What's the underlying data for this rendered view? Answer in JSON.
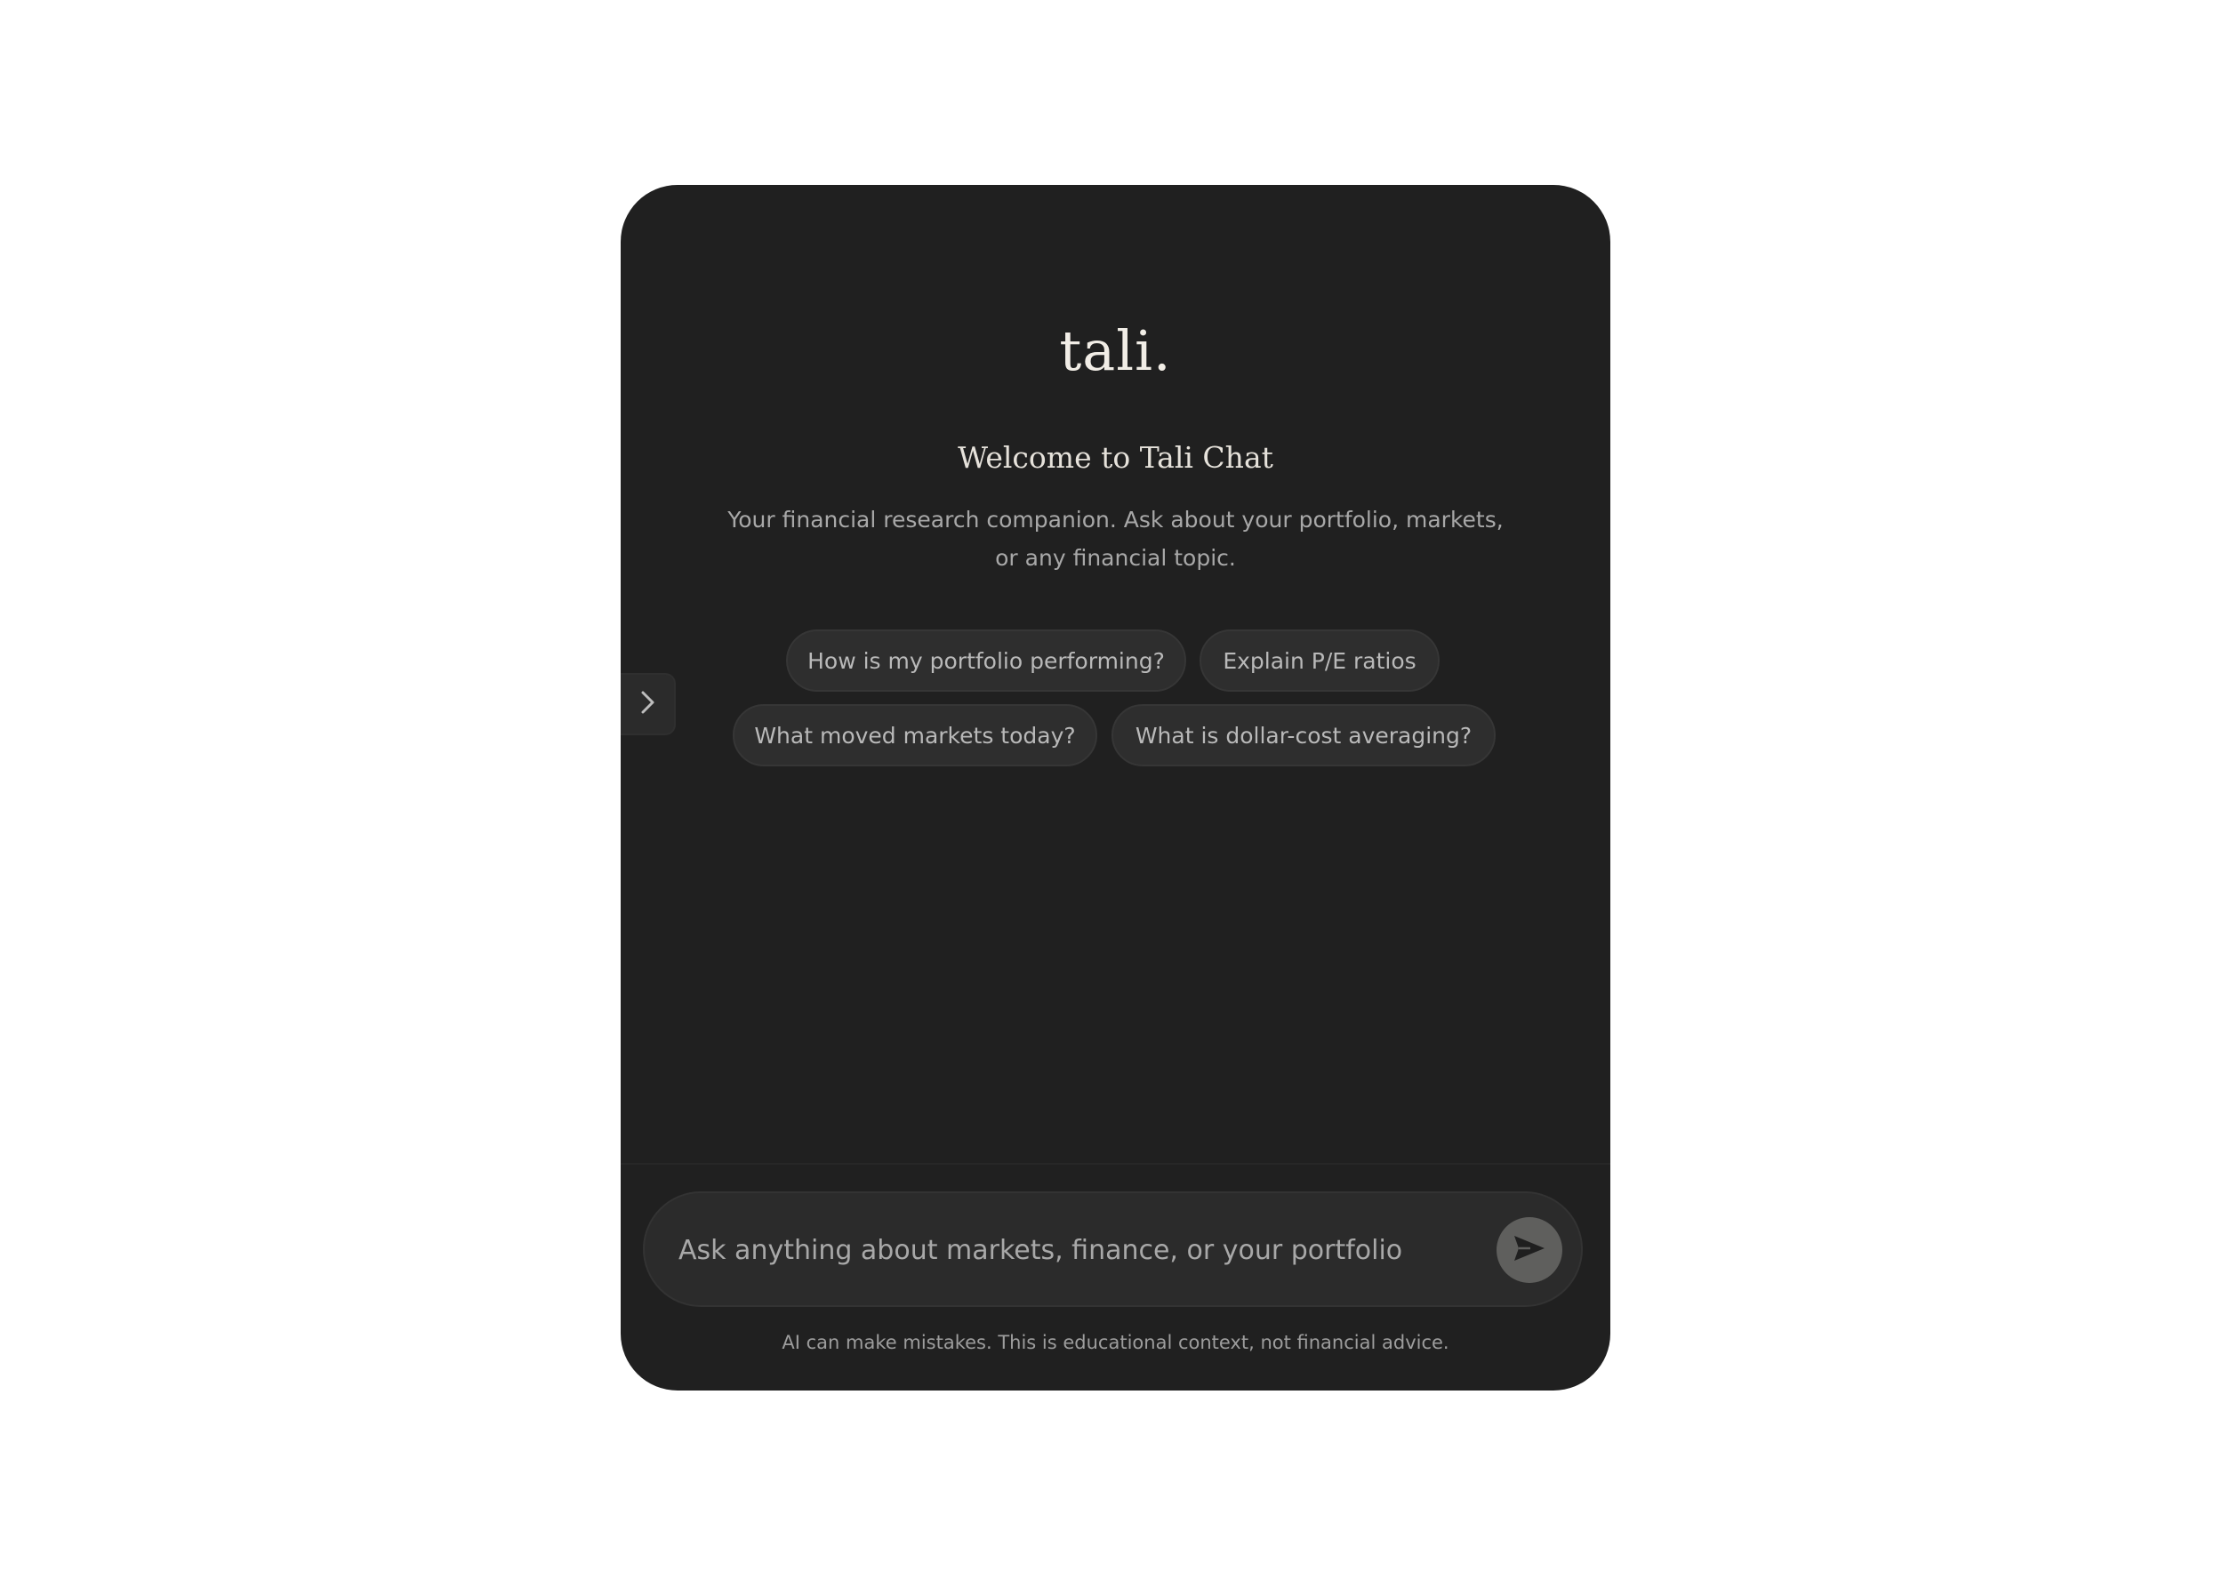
{
  "brand": {
    "logo_text": "tali."
  },
  "welcome": {
    "title": "Welcome to Tali Chat",
    "subtitle": "Your financial research companion. Ask about your portfolio, markets, or any financial topic."
  },
  "suggestions": [
    {
      "label": "How is my portfolio performing?"
    },
    {
      "label": "Explain P/E ratios"
    },
    {
      "label": "What moved markets today?"
    },
    {
      "label": "What is dollar-cost averaging?"
    }
  ],
  "composer": {
    "placeholder": "Ask anything about markets, finance, or your portfolio",
    "value": ""
  },
  "footer": {
    "disclaimer": "AI can make mistakes. This is educational context, not financial advice."
  },
  "icons": {
    "sidebar_toggle": "chevron-right-icon",
    "send": "send-icon"
  },
  "colors": {
    "card_background": "#202020",
    "page_background": "#ffffff",
    "chip_background": "#2e2e2e",
    "send_button": "#5f5f5d"
  }
}
